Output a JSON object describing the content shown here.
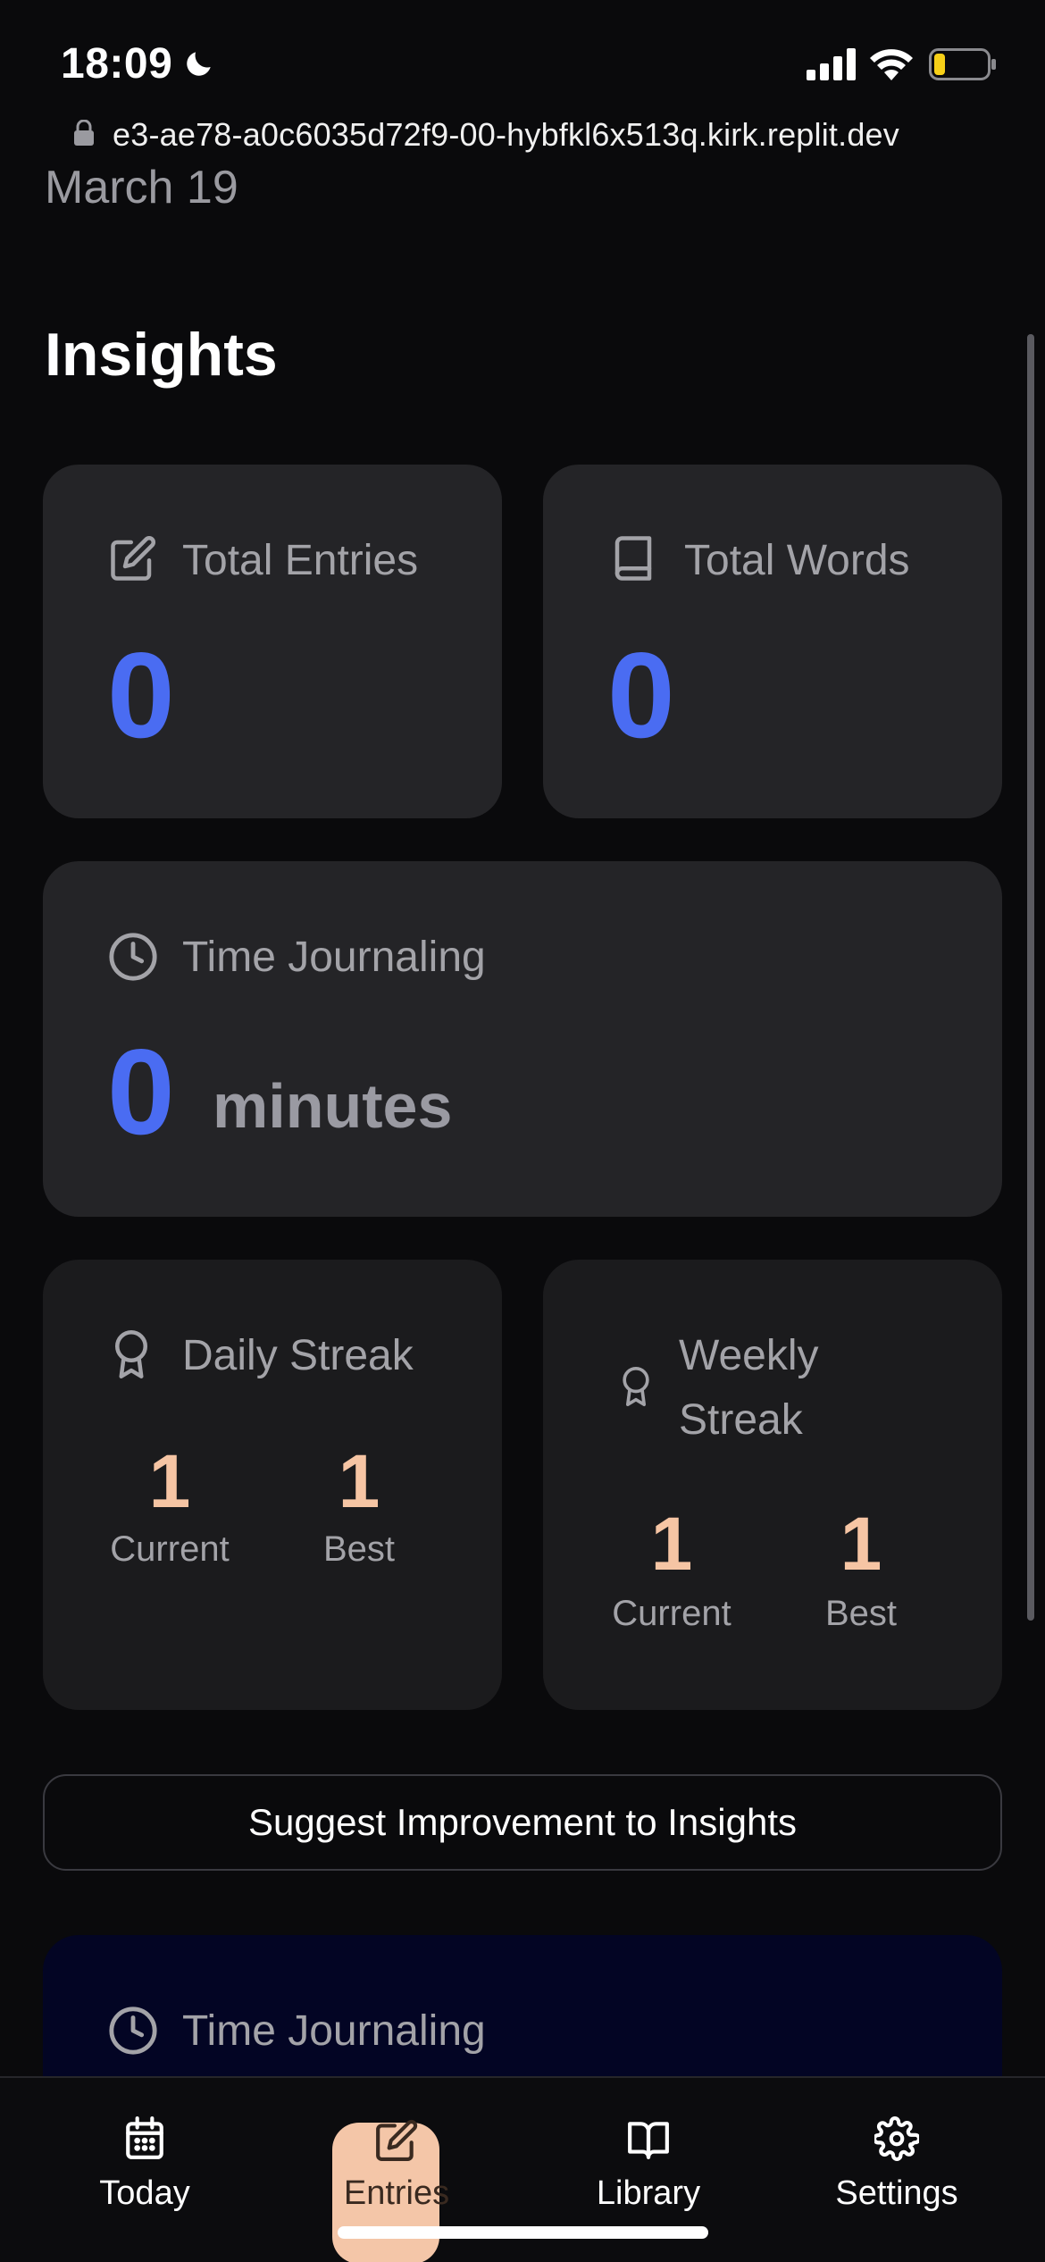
{
  "status_bar": {
    "time": "18:09",
    "battery_color": "#f7d018"
  },
  "browser": {
    "url": "e3-ae78-a0c6035d72f9-00-hybfkl6x513q.kirk.replit.dev"
  },
  "page": {
    "date_peek": "March 19",
    "title": "Insights"
  },
  "cards": {
    "total_entries": {
      "label": "Total Entries",
      "value": "0",
      "icon": "edit-icon"
    },
    "total_words": {
      "label": "Total Words",
      "value": "0",
      "icon": "book-icon"
    },
    "time_journaling": {
      "label": "Time Journaling",
      "value": "0",
      "unit": "minutes",
      "icon": "clock-icon"
    },
    "daily_streak": {
      "label": "Daily Streak",
      "current_value": "1",
      "current_label": "Current",
      "best_value": "1",
      "best_label": "Best",
      "icon": "award-icon"
    },
    "weekly_streak": {
      "label_line1": "Weekly",
      "label_line2": "Streak",
      "current_value": "1",
      "current_label": "Current",
      "best_value": "1",
      "best_label": "Best",
      "icon": "award-icon"
    }
  },
  "suggest_button": {
    "label": "Suggest Improvement to Insights"
  },
  "time_journaling_chart": {
    "label": "Time Journaling",
    "icon": "clock-icon"
  },
  "tab_bar": {
    "tabs": [
      {
        "label": "Today",
        "icon": "calendar-icon",
        "active": false
      },
      {
        "label": "Entries",
        "icon": "edit-icon",
        "active": true
      },
      {
        "label": "Library",
        "icon": "book-open-icon",
        "active": false
      },
      {
        "label": "Settings",
        "icon": "gear-icon",
        "active": false
      }
    ]
  },
  "colors": {
    "accent_blue": "#4a6cf2",
    "streak_peach": "#f6c5a4",
    "active_tab_bg": "#f4c6a8",
    "card_bg": "#242427"
  }
}
